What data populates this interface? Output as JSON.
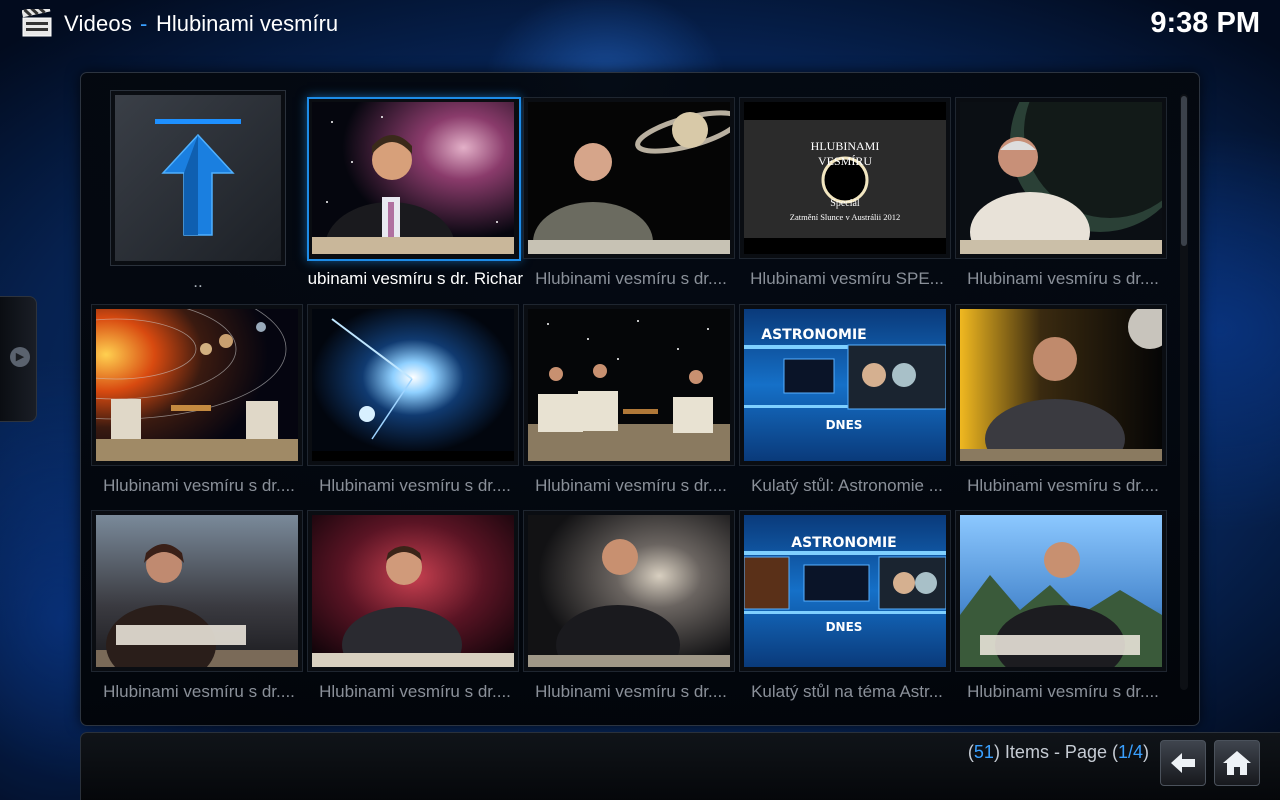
{
  "header": {
    "section": "Videos",
    "separator": "-",
    "folder": "Hlubinami vesmíru",
    "clock": "9:38 PM"
  },
  "parent_item": {
    "label": ".."
  },
  "items": [
    {
      "label": "Hlubinami vesmíru s dr. Richar",
      "focused": true
    },
    {
      "label": "Hlubinami vesmíru s dr...."
    },
    {
      "label": "Hlubinami vesmíru SPE..."
    },
    {
      "label": "Hlubinami vesmíru s dr...."
    },
    {
      "label": "Hlubinami vesmíru s dr...."
    },
    {
      "label": "Hlubinami vesmíru s dr...."
    },
    {
      "label": "Hlubinami vesmíru s dr...."
    },
    {
      "label": "Kulatý stůl: Astronomie ..."
    },
    {
      "label": "Hlubinami vesmíru s dr...."
    },
    {
      "label": "Hlubinami vesmíru s dr...."
    },
    {
      "label": "Hlubinami vesmíru s dr...."
    },
    {
      "label": "Hlubinami vesmíru s dr...."
    },
    {
      "label": "Kulatý stůl na téma Astr..."
    },
    {
      "label": "Hlubinami vesmíru s dr...."
    }
  ],
  "thumb_text": {
    "special_title_1": "HLUBINAMI",
    "special_title_2": "VESMÍRU",
    "special_sub_1": "Speciál",
    "special_sub_2": "Zatmění Slunce v Austrálii 2012",
    "astro_top": "ASTRONOMIE",
    "astro_bottom": "DNES"
  },
  "footer": {
    "open_paren": "(",
    "count": "51",
    "mid": ") Items - Page (",
    "page": "1/4",
    "close_paren": ")"
  },
  "icons": {
    "header": "clapperboard-icon",
    "back": "back-arrow-icon",
    "home": "home-icon",
    "parent": "up-arrow-icon"
  },
  "colors": {
    "accent": "#1d8ce8",
    "highlight_text": "#3aa0ff"
  }
}
